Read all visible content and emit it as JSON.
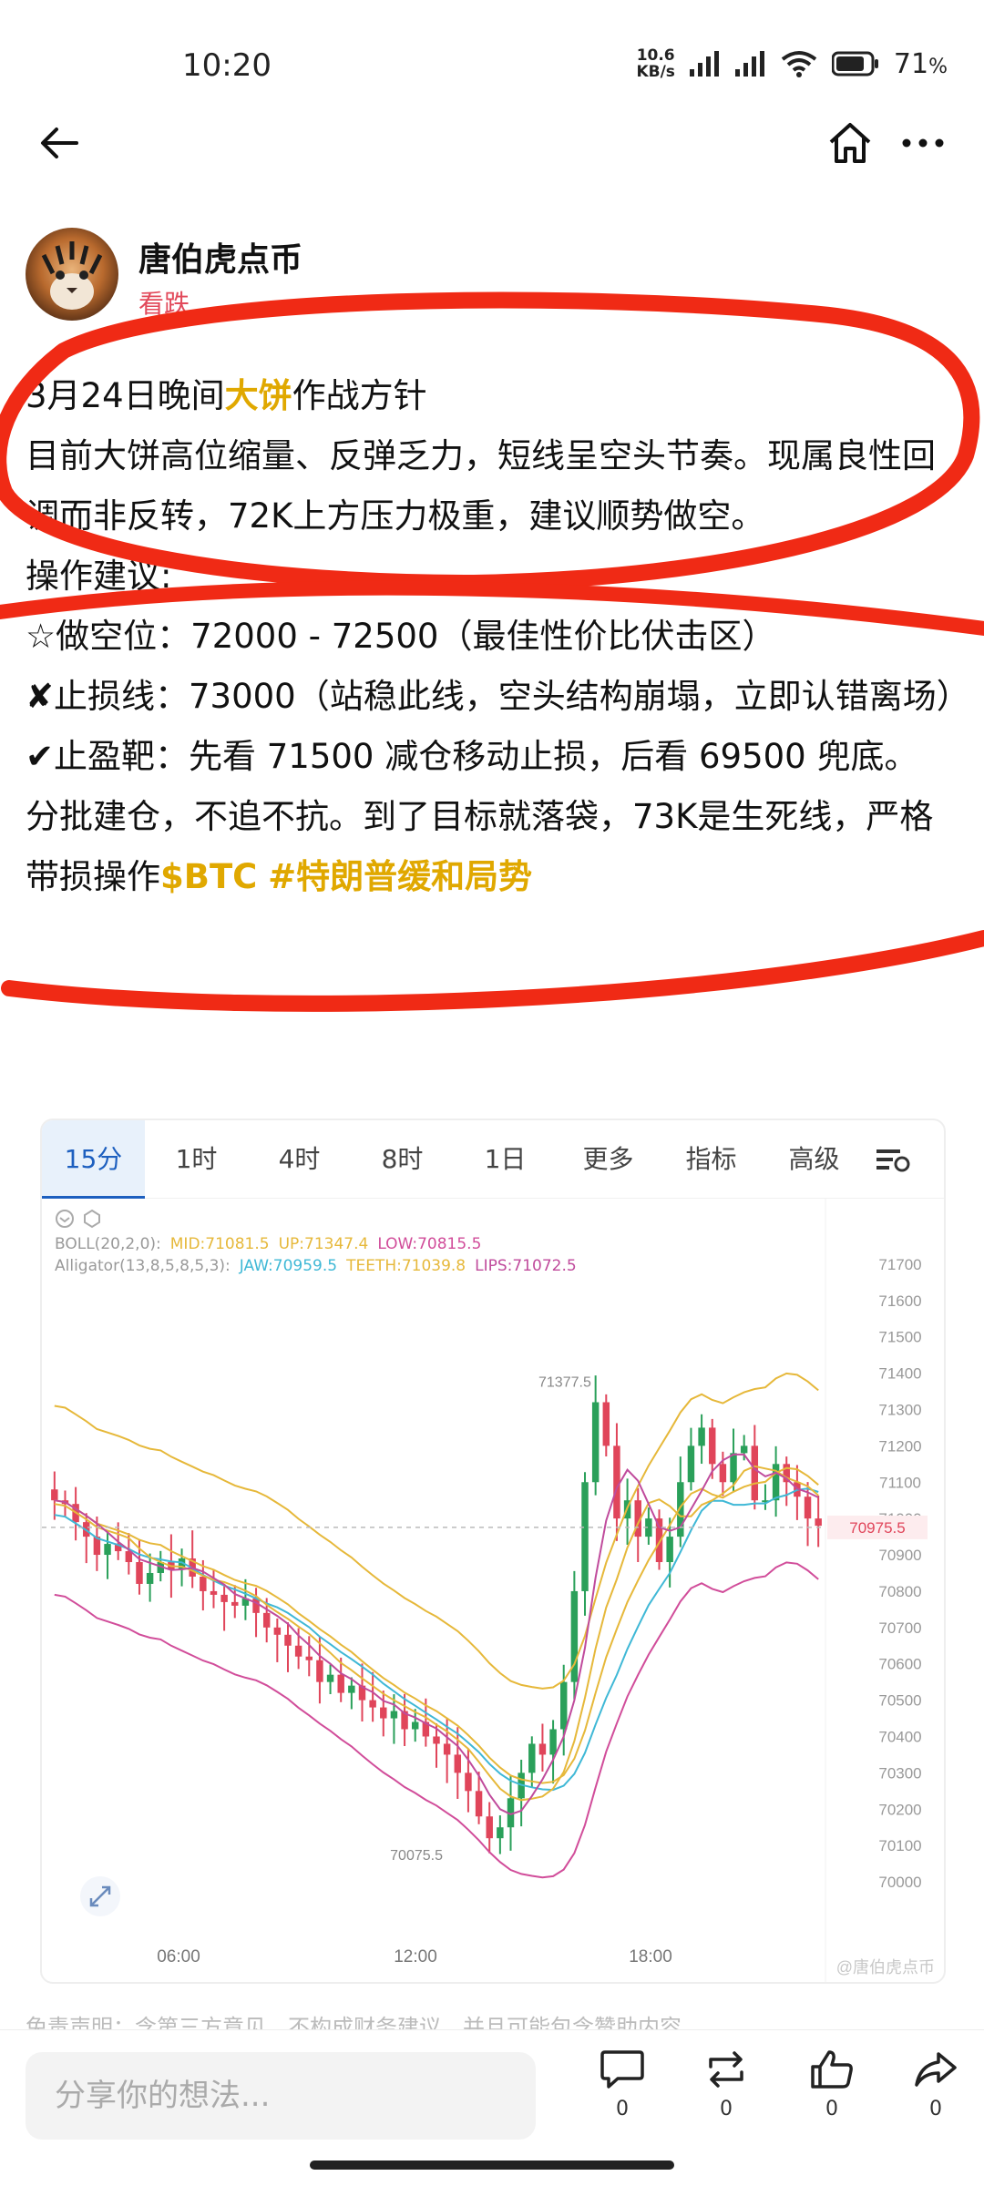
{
  "status_bar": {
    "time": "10:20",
    "net_speed_value": "10.6",
    "net_speed_unit": "KB/s",
    "battery": "71",
    "battery_unit": "%"
  },
  "author": {
    "name": "唐伯虎点币",
    "stance": "看跌"
  },
  "post": {
    "line1_pre": "3月24日晚间",
    "line1_highlight": "大饼",
    "line1_post": "作战方针",
    "para1": "目前大饼高位缩量、反弹乏力，短线呈空头节奏。现属良性回调而非反转，72K上方压力极重，建议顺势做空。",
    "ops_title": "操作建议:",
    "entry": "☆做空位：72000 - 72500（最佳性价比伏击区）",
    "stoploss": "✘止损线：73000（站稳此线，空头结构崩塌，立即认错离场）",
    "takeprofit": "✔止盈靶：先看 71500 减仓移动止损，后看 69500 兜底。",
    "closing": "分批建仓，不追不抗。到了目标就落袋，73K是生死线，严格带损操作",
    "tag1": "$BTC",
    "tag2": "#特朗普缓和局势"
  },
  "chart_tabs": [
    "15分",
    "1时",
    "4时",
    "8时",
    "1日",
    "更多",
    "指标",
    "高级"
  ],
  "indicators": {
    "boll_label": "BOLL(20,2,0):",
    "boll_mid": "MID:71081.5",
    "boll_up": "UP:71347.4",
    "boll_low": "LOW:70815.5",
    "alligator_label": "Alligator(13,8,5,8,5,3):",
    "jaw": "JAW:70959.5",
    "teeth": "TEETH:71039.8",
    "lips": "LIPS:71072.5"
  },
  "colors": {
    "mid": "#e6b83a",
    "up": "#e6b83a",
    "low": "#d14d9a",
    "jaw": "#3fb8d6",
    "teeth": "#e6b83a",
    "lips": "#c04b9c",
    "bull": "#2aa05a",
    "bear": "#e0455a",
    "highlight": "#e0a800"
  },
  "chart_data": {
    "type": "candlestick",
    "title": "",
    "y_ticks": [
      71700,
      71600,
      71500,
      71400,
      71300,
      71200,
      71100,
      71000,
      70900,
      70800,
      70700,
      70600,
      70500,
      70400,
      70300,
      70200,
      70100,
      70000
    ],
    "x_ticks": [
      "06:00",
      "12:00",
      "18:00"
    ],
    "ylim": [
      69950,
      71780
    ],
    "current_price": "70975.5",
    "annotations": {
      "high": "71377.5",
      "low": "70075.5"
    },
    "watermark": "@唐伯虎点币"
  },
  "disclaimer": "免责声明：含第三方意见，不构成财务建议，并且可能包含赞助内容。",
  "share_placeholder": "分享你的想法...",
  "actions": {
    "comment": "0",
    "repost": "0",
    "like": "0",
    "share": "0"
  }
}
